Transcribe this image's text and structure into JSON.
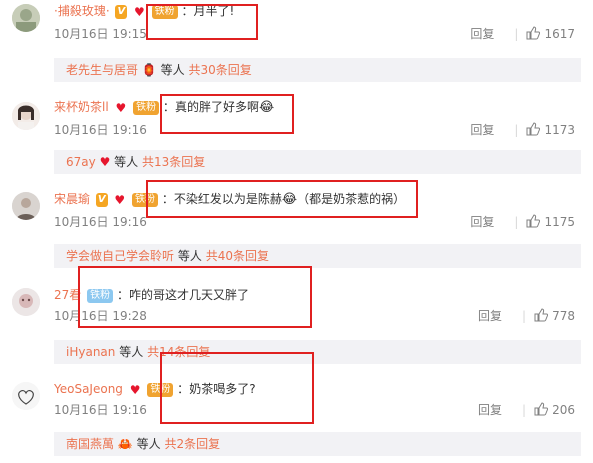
{
  "comments": [
    {
      "username": "·捕殺玫瑰·",
      "badges": [
        "V",
        "♥",
        "铁粉"
      ],
      "text": "月半了!",
      "emoji": "",
      "date": "10月16日 19:15",
      "reply_label": "回复",
      "likes": "1617",
      "sub_reply": {
        "user": "老先生与居哥",
        "user_icon": "🏮",
        "suffix": "等人",
        "more": "共30条回复"
      }
    },
    {
      "username": "来杯奶茶ll",
      "badges": [
        "♥",
        "铁粉"
      ],
      "text": "真的胖了好多啊",
      "emoji": "😂",
      "date": "10月16日 19:16",
      "reply_label": "回复",
      "likes": "1173",
      "sub_reply": {
        "user": "67ay",
        "user_icon": "♥",
        "suffix": "等人",
        "more": "共13条回复"
      }
    },
    {
      "username": "宋晨瑜",
      "badges": [
        "V",
        "♥",
        "铁粉"
      ],
      "text": "不染红发以为是陈赫",
      "emoji": "😂",
      "text_after": "（都是奶茶惹的祸）",
      "date": "10月16日 19:16",
      "reply_label": "回复",
      "likes": "1175",
      "sub_reply": {
        "user": "学会做自己学会聆听",
        "user_icon": "",
        "suffix": "等人",
        "more": "共40条回复"
      }
    },
    {
      "username": "27看",
      "badges": [
        "铁粉"
      ],
      "text": "咋的哥这才几天又胖了",
      "emoji": "",
      "date": "10月16日 19:28",
      "reply_label": "回复",
      "likes": "778",
      "sub_reply": {
        "user": "iHyanan",
        "user_icon": "",
        "suffix": "等人",
        "more": "共14条回复"
      }
    },
    {
      "username": "YeoSaJeong",
      "badges": [
        "♥",
        "铁粉"
      ],
      "text": "奶茶喝多了?",
      "emoji": "",
      "date": "10月16日 19:16",
      "reply_label": "回复",
      "likes": "206",
      "sub_reply": {
        "user": "南国燕萬",
        "user_icon": "🦀",
        "suffix": "等人",
        "more": "共2条回复"
      }
    }
  ],
  "colors": {
    "username": "#eb7350",
    "highlight_box": "#e02020",
    "subbar_bg": "#f2f2f5"
  }
}
